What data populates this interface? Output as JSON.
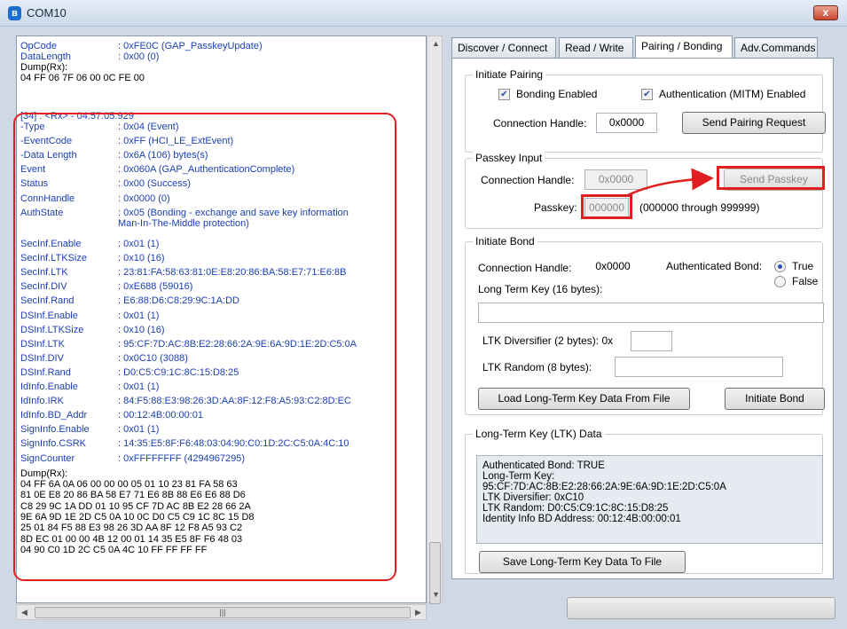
{
  "window": {
    "title": "COM10",
    "close_glyph": "x"
  },
  "log": {
    "top_lines": [
      {
        "key": "OpCode",
        "value": ": 0xFE0C (GAP_PasskeyUpdate)"
      },
      {
        "key": "DataLength",
        "value": ": 0x00 (0)"
      }
    ],
    "top_dump_label": "Dump(Rx):",
    "top_dump": "04 FF 06 7F 06 00 0C FE 00",
    "entry_header": "[34] : <Rx> - 04:57:05.929",
    "fields": [
      {
        "key": "-Type",
        "value": ": 0x04 (Event)"
      },
      {
        "key": "-EventCode",
        "value": ": 0xFF (HCI_LE_ExtEvent)"
      },
      {
        "key": "-Data Length",
        "value": ": 0x6A (106) bytes(s)"
      },
      {
        "key": " Event",
        "value": ": 0x060A (GAP_AuthenticationComplete)"
      },
      {
        "key": " Status",
        "value": ": 0x00 (Success)"
      },
      {
        "key": " ConnHandle",
        "value": ": 0x0000 (0)"
      },
      {
        "key": " AuthState",
        "value": ": 0x05 (Bonding - exchange and save key information"
      },
      {
        "key": "",
        "value": "  Man-In-The-Middle protection)"
      },
      {
        "key": " SecInf.Enable",
        "value": ": 0x01 (1)"
      },
      {
        "key": " SecInf.LTKSize",
        "value": ": 0x10 (16)"
      },
      {
        "key": " SecInf.LTK",
        "value": ": 23:81:FA:58:63:81:0E:E8:20:86:BA:58:E7:71:E6:8B"
      },
      {
        "key": " SecInf.DIV",
        "value": ": 0xE688 (59016)"
      },
      {
        "key": " SecInf.Rand",
        "value": ": E6:88:D6:C8:29:9C:1A:DD"
      },
      {
        "key": " DSInf.Enable",
        "value": ": 0x01 (1)"
      },
      {
        "key": " DSInf.LTKSize",
        "value": ": 0x10 (16)"
      },
      {
        "key": " DSInf.LTK",
        "value": ": 95:CF:7D:AC:8B:E2:28:66:2A:9E:6A:9D:1E:2D:C5:0A"
      },
      {
        "key": " DSInf.DIV",
        "value": ": 0x0C10 (3088)"
      },
      {
        "key": " DSInf.Rand",
        "value": ": D0:C5:C9:1C:8C:15:D8:25"
      },
      {
        "key": " IdInfo.Enable",
        "value": ": 0x01 (1)"
      },
      {
        "key": " IdInfo.IRK",
        "value": ": 84:F5:88:E3:98:26:3D:AA:8F:12:F8:A5:93:C2:8D:EC"
      },
      {
        "key": " IdInfo.BD_Addr",
        "value": ": 00:12:4B:00:00:01"
      },
      {
        "key": " SignInfo.Enable",
        "value": ": 0x01 (1)"
      },
      {
        "key": " SignInfo.CSRK",
        "value": ": 14:35:E5:8F:F6:48:03:04:90:C0:1D:2C:C5:0A:4C:10"
      },
      {
        "key": " SignCounter",
        "value": ": 0xFFFFFFFF (4294967295)"
      }
    ],
    "dump_label": "Dump(Rx):",
    "dump_lines": [
      "04 FF 6A 0A 06 00 00 00 05 01 10 23 81 FA 58 63",
      "81 0E E8 20 86 BA 58 E7 71 E6 8B 88 E6 E6 88 D6",
      "C8 29 9C 1A DD 01 10 95 CF 7D AC 8B E2 28 66 2A",
      "9E 6A 9D 1E 2D C5 0A 10 0C D0 C5 C9 1C 8C 15 D8",
      "25 01 84 F5 88 E3 98 26 3D AA 8F 12 F8 A5 93 C2",
      "8D EC 01 00 00 4B 12 00 01 14 35 E5 8F F6 48 03",
      "04 90 C0 1D 2C C5 0A 4C 10 FF FF FF FF"
    ]
  },
  "tabs": [
    {
      "label": "Discover / Connect"
    },
    {
      "label": "Read / Write"
    },
    {
      "label": "Pairing / Bonding"
    },
    {
      "label": "Adv.Commands"
    }
  ],
  "initiate_pairing": {
    "title": "Initiate Pairing",
    "bonding_label": "Bonding Enabled",
    "auth_label": "Authentication (MITM) Enabled",
    "conn_label": "Connection Handle:",
    "conn_value": "0x0000",
    "send_button": "Send Pairing Request"
  },
  "passkey_input": {
    "title": "Passkey Input",
    "conn_label": "Connection Handle:",
    "conn_value": "0x0000",
    "send_button": "Send Passkey",
    "passkey_label": "Passkey:",
    "passkey_value": "000000",
    "range": "(000000 through 999999)"
  },
  "initiate_bond": {
    "title": "Initiate Bond",
    "conn_label": "Connection Handle:",
    "conn_value": "0x0000",
    "auth_bond_label": "Authenticated Bond:",
    "true_label": "True",
    "false_label": "False",
    "ltk_label": "Long Term Key (16 bytes):",
    "ltk_value": "",
    "div_label": "LTK Diversifier (2 bytes): 0x",
    "div_value": "",
    "rand_label": "LTK Random (8 bytes):",
    "rand_value": "",
    "load_button": "Load Long-Term Key Data From File",
    "bond_button": "Initiate Bond"
  },
  "ltk_data": {
    "title": "Long-Term Key (LTK) Data",
    "lines": [
      "Authenticated Bond: TRUE",
      "Long-Term Key:",
      "95:CF:7D:AC:8B:E2:28:66:2A:9E:6A:9D:1E:2D:C5:0A",
      "LTK Diversifier: 0xC10",
      "LTK Random: D0:C5:C9:1C:8C:15:D8:25",
      "Identity Info BD Address: 00:12:4B:00:00:01"
    ],
    "save_button": "Save Long-Term Key Data To File"
  },
  "colors": {
    "highlight": "#e02020",
    "log_text": "#1c40b5"
  }
}
